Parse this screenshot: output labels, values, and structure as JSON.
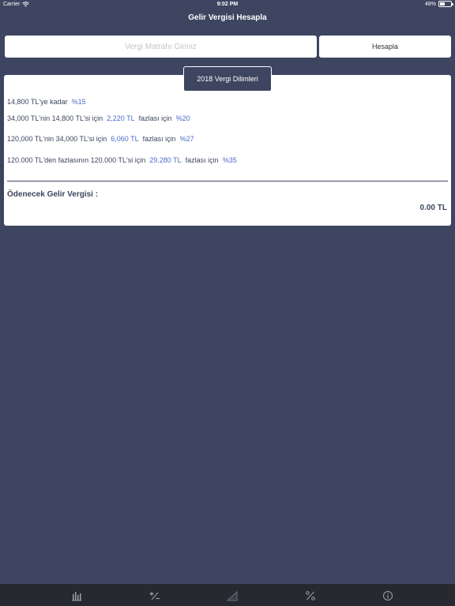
{
  "status": {
    "carrier": "Carrier",
    "time": "9:02 PM",
    "battery": "48%"
  },
  "nav": {
    "title": "Gelir Vergisi Hesapla"
  },
  "input": {
    "placeholder": "Vergi Matrahı Giriniz"
  },
  "button": {
    "calculate": "Hesapla"
  },
  "tab": {
    "label": "2018 Vergi Dilimleri"
  },
  "brackets": [
    {
      "text": "14,800 TL'ye kadar",
      "rate": "%15"
    },
    {
      "text": "34,000 TL'nin 14,800 TL'si için",
      "amount": "2,220 TL",
      "suffix": "fazlası için",
      "rate": "%20"
    },
    {
      "text": "120,000 TL'nin 34,000 TL'si için",
      "amount": "6,060 TL",
      "suffix": "fazlası için",
      "rate": "%27"
    },
    {
      "text": "120.000 TL'den fazlasının 120.000 TL'si için",
      "amount": "29.280 TL",
      "suffix": "fazlası için",
      "rate": "%35"
    }
  ],
  "result": {
    "label": "Ödenecek Gelir Vergisi :",
    "value": "0.00 TL"
  },
  "tabbar": {
    "items": [
      "chart-icon",
      "plus-minus-icon",
      "ramp-icon",
      "percent-icon",
      "info-icon"
    ]
  }
}
